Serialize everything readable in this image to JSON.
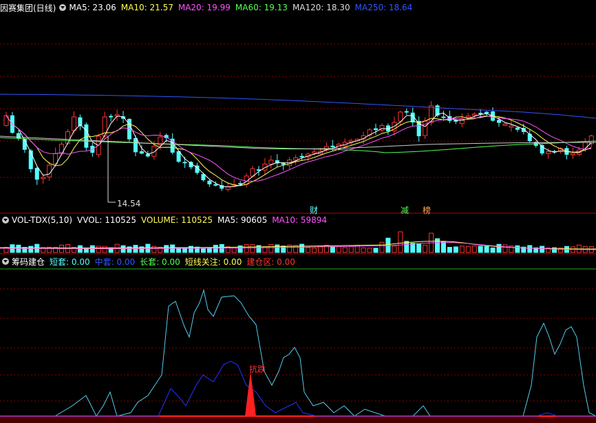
{
  "panel_main": {
    "title": "因赛集团(日线)",
    "ma": [
      {
        "label": "MA5: 23.06",
        "color": "#ffffff"
      },
      {
        "label": "MA10: 21.57",
        "color": "#ffff55"
      },
      {
        "label": "MA20: 19.99",
        "color": "#ff55ff"
      },
      {
        "label": "MA60: 19.13",
        "color": "#55ff55"
      },
      {
        "label": "MA120: 18.30",
        "color": "#dddddd"
      },
      {
        "label": "MA250: 18.64",
        "color": "#3355ff"
      }
    ],
    "low_marker": "14.54",
    "events": [
      {
        "label": "财",
        "color": "#55ffff"
      },
      {
        "label": "减",
        "color": "#55ff55"
      },
      {
        "label": "榜",
        "color": "#ffaa55"
      }
    ]
  },
  "panel_vol": {
    "title": "VOL-TDX(5,10)",
    "items": [
      {
        "label": "VVOL: 110525",
        "color": "#ffffff"
      },
      {
        "label": "VOLUME: 110525",
        "color": "#ffff55"
      },
      {
        "label": "MA5: 90605",
        "color": "#ffffff"
      },
      {
        "label": "MA10: 59894",
        "color": "#ff55ff"
      }
    ]
  },
  "panel_chip": {
    "title": "筹码建仓",
    "items": [
      {
        "label": "短套: 0.00",
        "color": "#55ffff"
      },
      {
        "label": "中套: 0.00",
        "color": "#3355ff"
      },
      {
        "label": "长套: 0.00",
        "color": "#55ff55"
      },
      {
        "label": "短线关注: 0.00",
        "color": "#ffff55"
      },
      {
        "label": "建仓区: 0.00",
        "color": "#ff3333"
      }
    ],
    "signal_label": "抗跌"
  },
  "colors": {
    "up": "#ff3333",
    "down": "#55ffff",
    "grid": "#8b0000",
    "separator": "#c00000"
  },
  "chart_data": {
    "type": "candlestick",
    "price_axis_low": 14.54,
    "series": [
      {
        "name": "MA5",
        "color": "#ffffff"
      },
      {
        "name": "MA10",
        "color": "#ffff55"
      },
      {
        "name": "MA20",
        "color": "#ff55ff"
      },
      {
        "name": "MA60",
        "color": "#55ff55"
      },
      {
        "name": "MA120",
        "color": "#dddddd"
      },
      {
        "name": "MA250",
        "color": "#3355ff"
      }
    ]
  }
}
